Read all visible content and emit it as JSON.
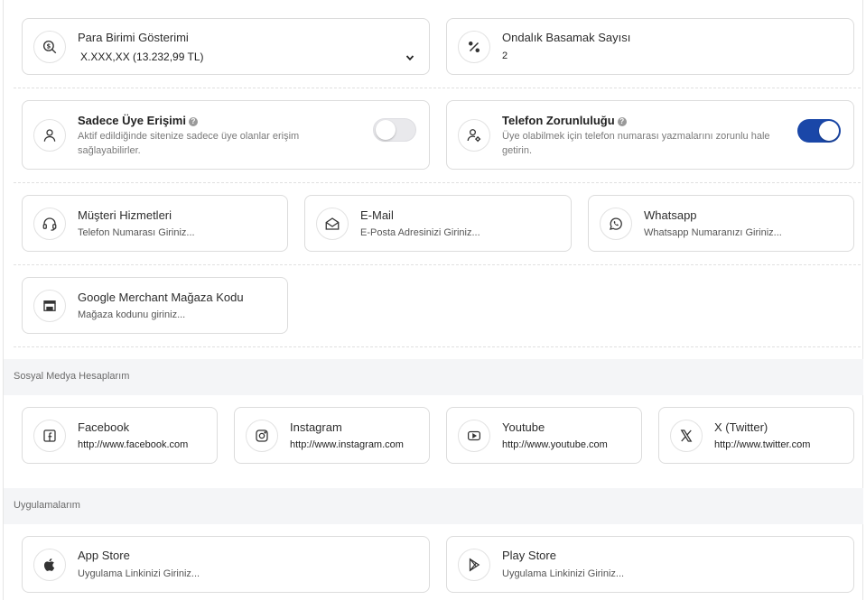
{
  "currency": {
    "title": "Para Birimi Gösterimi",
    "value": "X.XXX,XX (13.232,99 TL)"
  },
  "decimals": {
    "title": "Ondalık Basamak Sayısı",
    "value": "2"
  },
  "member_access": {
    "title": "Sadece Üye Erişimi",
    "help": "?",
    "description": "Aktif edildiğinde sitenize sadece üye olanlar erişim sağlayabilirler.",
    "enabled": false
  },
  "phone_required": {
    "title": "Telefon Zorunluluğu",
    "help": "?",
    "description": "Üye olabilmek için telefon numarası yazmalarını zorunlu hale getirin.",
    "enabled": true
  },
  "contacts": [
    {
      "title": "Müşteri Hizmetleri",
      "placeholder": "Telefon Numarası Giriniz..."
    },
    {
      "title": "E-Mail",
      "placeholder": "E-Posta Adresinizi Giriniz..."
    },
    {
      "title": "Whatsapp",
      "placeholder": "Whatsapp Numaranızı Giriniz..."
    }
  ],
  "merchant": {
    "title": "Google Merchant Mağaza Kodu",
    "placeholder": "Mağaza kodunu giriniz..."
  },
  "social_section": {
    "label": "Sosyal Medya Hesaplarım"
  },
  "social": [
    {
      "title": "Facebook",
      "value": "http://www.facebook.com"
    },
    {
      "title": "Instagram",
      "value": "http://www.instagram.com"
    },
    {
      "title": "Youtube",
      "value": "http://www.youtube.com"
    },
    {
      "title": "X (Twitter)",
      "value": "http://www.twitter.com"
    }
  ],
  "apps_section": {
    "label": "Uygulamalarım"
  },
  "apps": [
    {
      "title": "App Store",
      "placeholder": "Uygulama Linkinizi Giriniz..."
    },
    {
      "title": "Play Store",
      "placeholder": "Uygulama Linkinizi Giriniz..."
    }
  ],
  "colors": {
    "toggle_on": "#1a47a8",
    "section_bg": "#f4f5f7",
    "border": "#dcdcdc"
  }
}
